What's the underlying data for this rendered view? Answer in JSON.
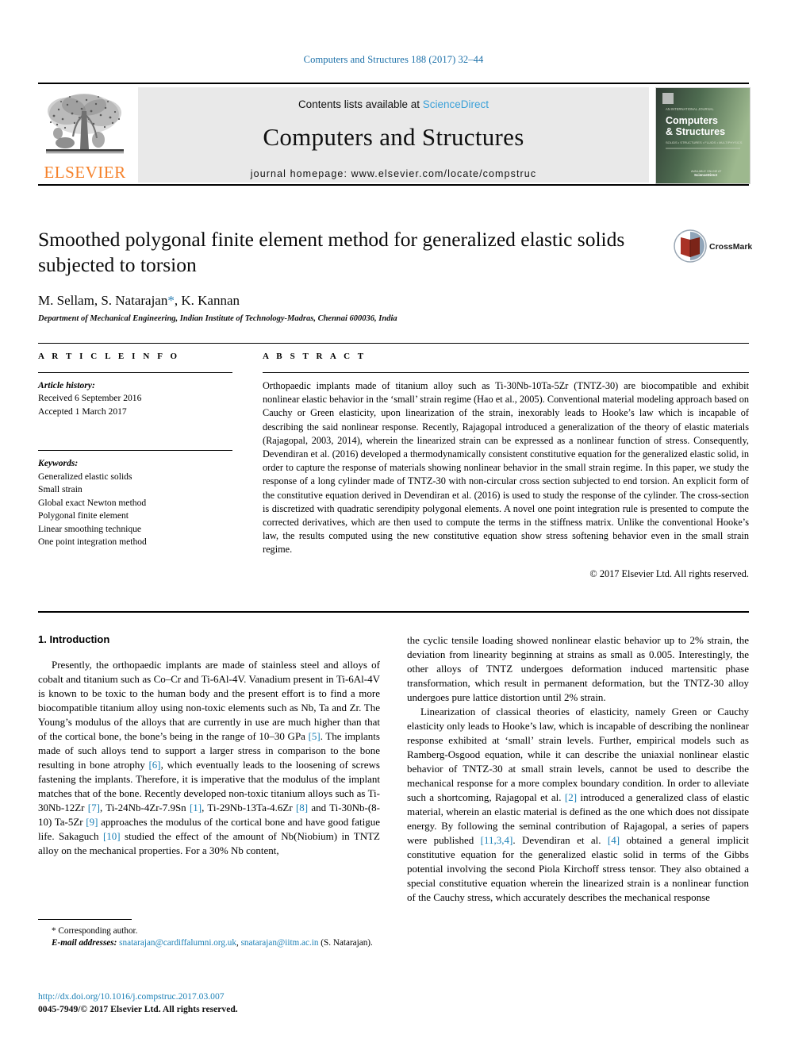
{
  "running_head": "Computers and Structures 188 (2017) 32–44",
  "masthead": {
    "publisher_name": "ELSEVIER",
    "contents_prefix": "Contents lists available at ",
    "sciencedirect": "ScienceDirect",
    "journal_name": "Computers and Structures",
    "homepage_line": "journal homepage: www.elsevier.com/locate/compstruc",
    "cover": {
      "title_line1": "Computers",
      "title_line2": "& Structures",
      "kicker": "AN INTERNATIONAL JOURNAL",
      "subtitle": "SOLIDS • STRUCTURES • FLUIDS • MULTIPHYSICS",
      "footer1": "AVAILABLE ONLINE AT",
      "footer2": "ScienceDirect"
    }
  },
  "article": {
    "title": "Smoothed polygonal finite element method for generalized elastic solids subjected to torsion",
    "authors_pre": "M. Sellam, S. Natarajan",
    "author_star": "*",
    "authors_post": ", K. Kannan",
    "affiliation": "Department of Mechanical Engineering, Indian Institute of Technology-Madras, Chennai 600036, India",
    "crossmark_label": "CrossMark"
  },
  "info": {
    "heading": "A R T I C L E   I N F O",
    "history_label": "Article history:",
    "received": "Received 6 September 2016",
    "accepted": "Accepted 1 March 2017",
    "keywords_label": "Keywords:",
    "keywords": [
      "Generalized elastic solids",
      "Small strain",
      "Global exact Newton method",
      "Polygonal finite element",
      "Linear smoothing technique",
      "One point integration method"
    ]
  },
  "abstract": {
    "heading": "A B S T R A C T",
    "text": "Orthopaedic implants made of titanium alloy such as Ti-30Nb-10Ta-5Zr (TNTZ-30) are biocompatible and exhibit nonlinear elastic behavior in the ‘small’ strain regime (Hao et al., 2005). Conventional material modeling approach based on Cauchy or Green elasticity, upon linearization of the strain, inexorably leads to Hooke’s law which is incapable of describing the said nonlinear response. Recently, Rajagopal introduced a generalization of the theory of elastic materials (Rajagopal, 2003, 2014), wherein the linearized strain can be expressed as a nonlinear function of stress. Consequently, Devendiran et al. (2016) developed a thermodynamically consistent constitutive equation for the generalized elastic solid, in order to capture the response of materials showing nonlinear behavior in the small strain regime. In this paper, we study the response of a long cylinder made of TNTZ-30 with non-circular cross section subjected to end torsion. An explicit form of the constitutive equation derived in Devendiran et al. (2016) is used to study the response of the cylinder. The cross-section is discretized with quadratic serendipity polygonal elements. A novel one point integration rule is presented to compute the corrected derivatives, which are then used to compute the terms in the stiffness matrix. Unlike the conventional Hooke’s law, the results computed using the new constitutive equation show stress softening behavior even in the small strain regime.",
    "copyright": "© 2017 Elsevier Ltd. All rights reserved."
  },
  "body": {
    "section_heading": "1. Introduction",
    "left_para_1_a": "Presently, the orthopaedic implants are made of stainless steel and alloys of cobalt and titanium such as Co–Cr and Ti-6Al-4V. Vanadium present in Ti-6Al-4V is known to be toxic to the human body and the present effort is to find a more biocompatible titanium alloy using non-toxic elements such as Nb, Ta and Zr. The Young’s modulus of the alloys that are currently in use are much higher than that of the cortical bone, the bone’s being in the range of 10–30 GPa ",
    "ref_5": "[5]",
    "left_para_1_b": ". The implants made of such alloys tend to support a larger stress in comparison to the bone resulting in bone atrophy ",
    "ref_6": "[6]",
    "left_para_1_c": ", which eventually leads to the loosening of screws fastening the implants. Therefore, it is imperative that the modulus of the implant matches that of the bone. Recently developed non-toxic titanium alloys such as Ti-30Nb-12Zr ",
    "ref_7": "[7]",
    "left_para_1_d": ", Ti-24Nb-4Zr-7.9Sn ",
    "ref_1": "[1]",
    "left_para_1_e": ", Ti-29Nb-13Ta-4.6Zr ",
    "ref_8": "[8]",
    "left_para_1_f": " and Ti-30Nb-(8-10) Ta-5Zr ",
    "ref_9": "[9]",
    "left_para_1_g": " approaches the modulus of the cortical bone and have good fatigue life. Sakaguch ",
    "ref_10": "[10]",
    "left_para_1_h": " studied the effect of the amount of Nb(Niobium) in TNTZ alloy on the mechanical properties. For a 30% Nb content,",
    "right_para_1": "the cyclic tensile loading showed nonlinear elastic behavior up to 2% strain, the deviation from linearity beginning at strains as small as 0.005. Interestingly, the other alloys of TNTZ undergoes deformation induced martensitic phase transformation, which result in permanent deformation, but the TNTZ-30 alloy undergoes pure lattice distortion until 2% strain.",
    "right_para_2_a": "Linearization of classical theories of elasticity, namely Green or Cauchy elasticity only leads to Hooke’s law, which is incapable of describing the nonlinear response exhibited at ‘small’ strain levels. Further, empirical models such as Ramberg-Osgood equation, while it can describe the uniaxial nonlinear elastic behavior of TNTZ-30 at small strain levels, cannot be used to describe the mechanical response for a more complex boundary condition. In order to alleviate such a shortcoming, Rajagopal et al. ",
    "ref_2": "[2]",
    "right_para_2_b": " introduced a generalized class of elastic material, wherein an elastic material is defined as the one which does not dissipate energy. By following the seminal contribution of Rajagopal, a series of papers were published ",
    "ref_11_3_4": "[11,3,4]",
    "right_para_2_c": ". Devendiran et al. ",
    "ref_4": "[4]",
    "right_para_2_d": " obtained a general implicit constitutive equation for the generalized elastic solid in terms of the Gibbs potential involving the second Piola Kirchoff stress tensor. They also obtained a special constitutive equation wherein the linearized strain is a nonlinear function of the Cauchy stress, which accurately describes the mechanical response"
  },
  "footnote": {
    "corresponding_marker": "*",
    "corresponding_text": " Corresponding author.",
    "email_label": "E-mail addresses:",
    "email_1": "snatarajan@cardiffalumni.org.uk",
    "email_sep": ", ",
    "email_2": "snatarajan@iitm.ac.in",
    "email_attrib": "(S. Natarajan)."
  },
  "footer": {
    "doi": "http://dx.doi.org/10.1016/j.compstruc.2017.03.007",
    "issn": "0045-7949/© 2017 Elsevier Ltd. All rights reserved."
  },
  "colors": {
    "link_blue": "#1a7fb5",
    "head_blue": "#1a6fa8",
    "elsevier_orange": "#f5812a",
    "sciencedirect_blue": "#3aa0d8"
  }
}
